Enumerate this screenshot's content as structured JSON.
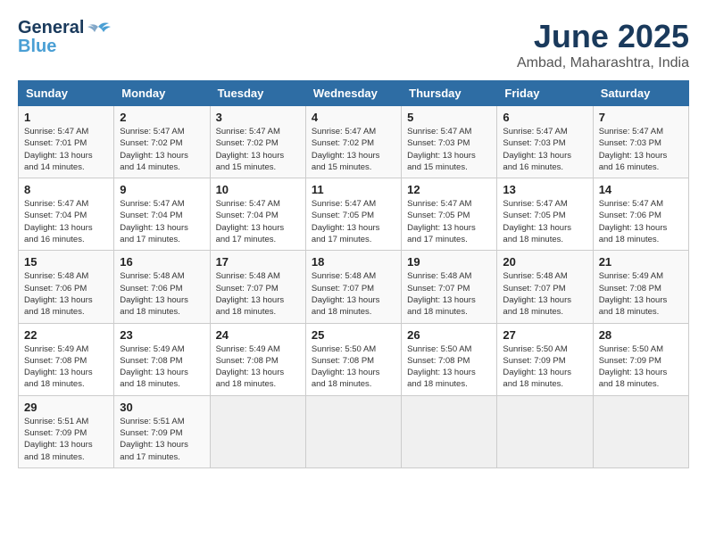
{
  "header": {
    "logo_line1": "General",
    "logo_line2": "Blue",
    "title": "June 2025",
    "subtitle": "Ambad, Maharashtra, India"
  },
  "weekdays": [
    "Sunday",
    "Monday",
    "Tuesday",
    "Wednesday",
    "Thursday",
    "Friday",
    "Saturday"
  ],
  "weeks": [
    [
      {
        "day": "1",
        "sunrise": "5:47 AM",
        "sunset": "7:01 PM",
        "daylight": "13 hours and 14 minutes."
      },
      {
        "day": "2",
        "sunrise": "5:47 AM",
        "sunset": "7:02 PM",
        "daylight": "13 hours and 14 minutes."
      },
      {
        "day": "3",
        "sunrise": "5:47 AM",
        "sunset": "7:02 PM",
        "daylight": "13 hours and 15 minutes."
      },
      {
        "day": "4",
        "sunrise": "5:47 AM",
        "sunset": "7:02 PM",
        "daylight": "13 hours and 15 minutes."
      },
      {
        "day": "5",
        "sunrise": "5:47 AM",
        "sunset": "7:03 PM",
        "daylight": "13 hours and 15 minutes."
      },
      {
        "day": "6",
        "sunrise": "5:47 AM",
        "sunset": "7:03 PM",
        "daylight": "13 hours and 16 minutes."
      },
      {
        "day": "7",
        "sunrise": "5:47 AM",
        "sunset": "7:03 PM",
        "daylight": "13 hours and 16 minutes."
      }
    ],
    [
      {
        "day": "8",
        "sunrise": "5:47 AM",
        "sunset": "7:04 PM",
        "daylight": "13 hours and 16 minutes."
      },
      {
        "day": "9",
        "sunrise": "5:47 AM",
        "sunset": "7:04 PM",
        "daylight": "13 hours and 17 minutes."
      },
      {
        "day": "10",
        "sunrise": "5:47 AM",
        "sunset": "7:04 PM",
        "daylight": "13 hours and 17 minutes."
      },
      {
        "day": "11",
        "sunrise": "5:47 AM",
        "sunset": "7:05 PM",
        "daylight": "13 hours and 17 minutes."
      },
      {
        "day": "12",
        "sunrise": "5:47 AM",
        "sunset": "7:05 PM",
        "daylight": "13 hours and 17 minutes."
      },
      {
        "day": "13",
        "sunrise": "5:47 AM",
        "sunset": "7:05 PM",
        "daylight": "13 hours and 18 minutes."
      },
      {
        "day": "14",
        "sunrise": "5:47 AM",
        "sunset": "7:06 PM",
        "daylight": "13 hours and 18 minutes."
      }
    ],
    [
      {
        "day": "15",
        "sunrise": "5:48 AM",
        "sunset": "7:06 PM",
        "daylight": "13 hours and 18 minutes."
      },
      {
        "day": "16",
        "sunrise": "5:48 AM",
        "sunset": "7:06 PM",
        "daylight": "13 hours and 18 minutes."
      },
      {
        "day": "17",
        "sunrise": "5:48 AM",
        "sunset": "7:07 PM",
        "daylight": "13 hours and 18 minutes."
      },
      {
        "day": "18",
        "sunrise": "5:48 AM",
        "sunset": "7:07 PM",
        "daylight": "13 hours and 18 minutes."
      },
      {
        "day": "19",
        "sunrise": "5:48 AM",
        "sunset": "7:07 PM",
        "daylight": "13 hours and 18 minutes."
      },
      {
        "day": "20",
        "sunrise": "5:48 AM",
        "sunset": "7:07 PM",
        "daylight": "13 hours and 18 minutes."
      },
      {
        "day": "21",
        "sunrise": "5:49 AM",
        "sunset": "7:08 PM",
        "daylight": "13 hours and 18 minutes."
      }
    ],
    [
      {
        "day": "22",
        "sunrise": "5:49 AM",
        "sunset": "7:08 PM",
        "daylight": "13 hours and 18 minutes."
      },
      {
        "day": "23",
        "sunrise": "5:49 AM",
        "sunset": "7:08 PM",
        "daylight": "13 hours and 18 minutes."
      },
      {
        "day": "24",
        "sunrise": "5:49 AM",
        "sunset": "7:08 PM",
        "daylight": "13 hours and 18 minutes."
      },
      {
        "day": "25",
        "sunrise": "5:50 AM",
        "sunset": "7:08 PM",
        "daylight": "13 hours and 18 minutes."
      },
      {
        "day": "26",
        "sunrise": "5:50 AM",
        "sunset": "7:08 PM",
        "daylight": "13 hours and 18 minutes."
      },
      {
        "day": "27",
        "sunrise": "5:50 AM",
        "sunset": "7:09 PM",
        "daylight": "13 hours and 18 minutes."
      },
      {
        "day": "28",
        "sunrise": "5:50 AM",
        "sunset": "7:09 PM",
        "daylight": "13 hours and 18 minutes."
      }
    ],
    [
      {
        "day": "29",
        "sunrise": "5:51 AM",
        "sunset": "7:09 PM",
        "daylight": "13 hours and 18 minutes."
      },
      {
        "day": "30",
        "sunrise": "5:51 AM",
        "sunset": "7:09 PM",
        "daylight": "13 hours and 17 minutes."
      },
      null,
      null,
      null,
      null,
      null
    ]
  ]
}
